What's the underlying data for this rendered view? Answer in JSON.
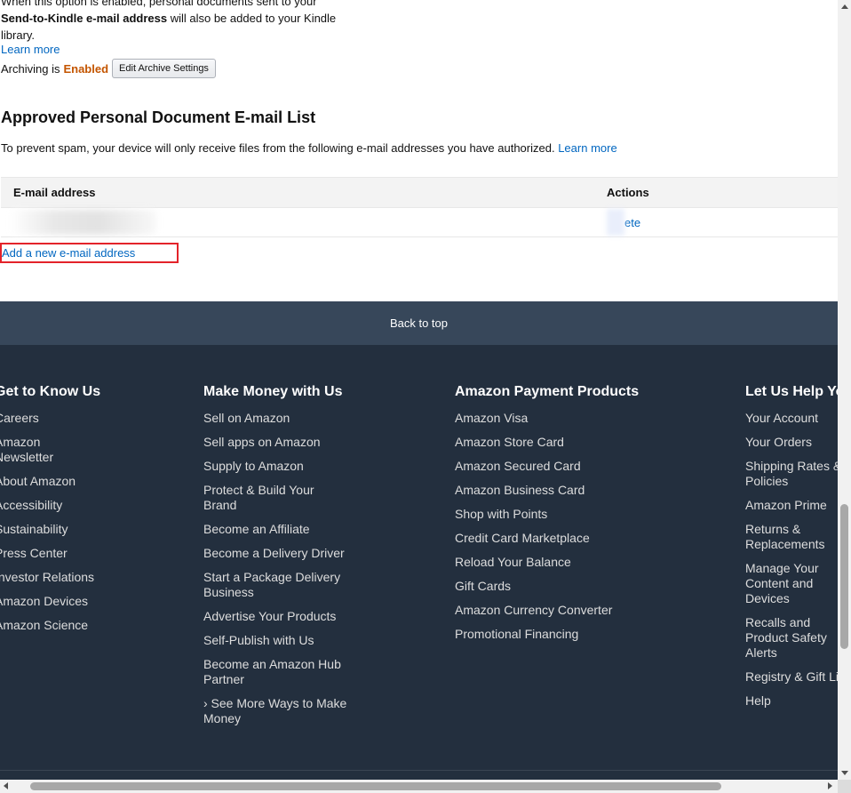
{
  "intro": {
    "line1": "When this option is enabled, personal documents sent to your",
    "bold": "Send-to-Kindle e-mail address",
    "line2": " will also be added to your Kindle",
    "line3": "library.",
    "learn_more": "Learn more",
    "archiving_label": "Archiving is",
    "archiving_status": "Enabled",
    "edit_button": "Edit Archive Settings"
  },
  "approved": {
    "title": "Approved Personal Document E-mail List",
    "description": "To prevent spam, your device will only receive files from the following e-mail addresses you have authorized.",
    "learn_more": "Learn more",
    "columns": [
      "E-mail address",
      "Actions"
    ],
    "rows": [
      {
        "email": "",
        "action": "ete"
      }
    ],
    "add_link": "Add a new e-mail address"
  },
  "footer": {
    "back_to_top": "Back to top",
    "columns": [
      {
        "title": "Get to Know Us",
        "items": [
          "Careers",
          "Amazon Newsletter",
          "About Amazon",
          "Accessibility",
          "Sustainability",
          "Press Center",
          "Investor Relations",
          "Amazon Devices",
          "Amazon Science"
        ]
      },
      {
        "title": "Make Money with Us",
        "items": [
          "Sell on Amazon",
          "Sell apps on Amazon",
          "Supply to Amazon",
          "Protect & Build Your Brand",
          "Become an Affiliate",
          "Become a Delivery Driver",
          "Start a Package Delivery Business",
          "Advertise Your Products",
          "Self-Publish with Us",
          "Become an Amazon Hub Partner",
          "› See More Ways to Make Money"
        ]
      },
      {
        "title": "Amazon Payment Products",
        "items": [
          "Amazon Visa",
          "Amazon Store Card",
          "Amazon Secured Card",
          "Amazon Business Card",
          "Shop with Points",
          "Credit Card Marketplace",
          "Reload Your Balance",
          "Gift Cards",
          "Amazon Currency Converter",
          "Promotional Financing"
        ]
      },
      {
        "title": "Let Us Help You",
        "items": [
          "Your Account",
          "Your Orders",
          "Shipping Rates & Policies",
          "Amazon Prime",
          "Returns & Replacements",
          "Manage Your Content and Devices",
          "Recalls and Product Safety Alerts",
          "Registry & Gift List",
          "Help"
        ]
      }
    ]
  },
  "colors": {
    "link": "#0066c0",
    "enabled": "#c45500",
    "highlight": "#e3232a",
    "footer_bg": "#232f3e",
    "back_top_bg": "#37475a"
  }
}
